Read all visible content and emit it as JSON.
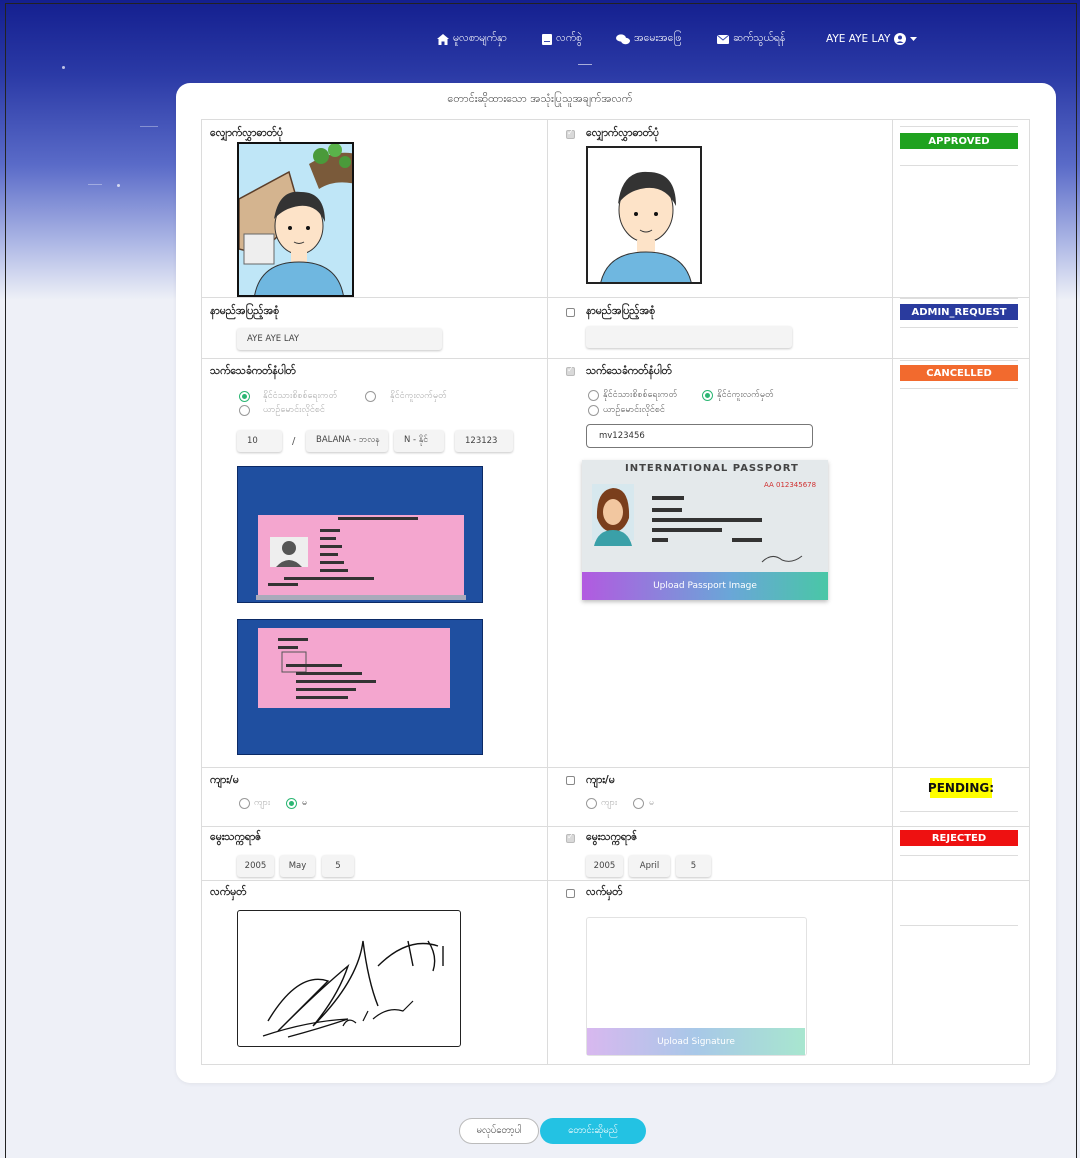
{
  "nav": {
    "home": "မူလစာမျက်နှာ",
    "register": "လက်စွဲ",
    "faq": "အမေးအဖြေ",
    "contact": "ဆက်သွယ်ရန်",
    "user": "AYE AYE LAY"
  },
  "card": {
    "title": "တောင်းဆိုထားသော အသုံးပြုသူအချက်အလက်"
  },
  "rows": {
    "photo": {
      "label": "လျှောက်လွှာဓာတ်ပုံ",
      "status": "APPROVED",
      "status_color": "#1fa21f"
    },
    "name": {
      "label": "နာမည်အပြည့်အစုံ",
      "value": "AYE AYE LAY",
      "new_value": "",
      "status": "ADMIN_REQUEST",
      "status_color": "#2a3b9e"
    },
    "nrc": {
      "label": "သက်သေခံကတ်နံပါတ်",
      "option_nrc": "နိုင်ငံသားစိစစ်ရေးကတ်",
      "option_passport": "နိုင်ငံကူးလက်မှတ်",
      "option_driver": "ယာဉ်မောင်းလိုင်စင်",
      "state": "10",
      "slash": "/",
      "township": "BALANA - ဘလန",
      "type": "N - နိုင်",
      "number": "123123",
      "passport_no": "mv123456",
      "passport_title": "INTERNATIONAL PASSPORT",
      "passport_number": "AA 012345678",
      "upload_passport": "Upload Passport Image",
      "status": "CANCELLED",
      "status_color": "#f26a2e"
    },
    "gender": {
      "label": "ကျား/မ",
      "male": "ကျား",
      "female": "မ",
      "status": "PENDING:",
      "status_color": "#ffff00"
    },
    "dob": {
      "label": "မွေးသက္ကရာဇ်",
      "year": "2005",
      "month": "May",
      "day": "5",
      "new_year": "2005",
      "new_month": "April",
      "new_day": "5",
      "status": "REJECTED",
      "status_color": "#ee1111"
    },
    "signature": {
      "label": "လက်မှတ်",
      "upload_signature": "Upload Signature"
    }
  },
  "footer": {
    "cancel": "မလုပ်တော့ပါ",
    "submit": "တောင်းဆိုမည်"
  }
}
